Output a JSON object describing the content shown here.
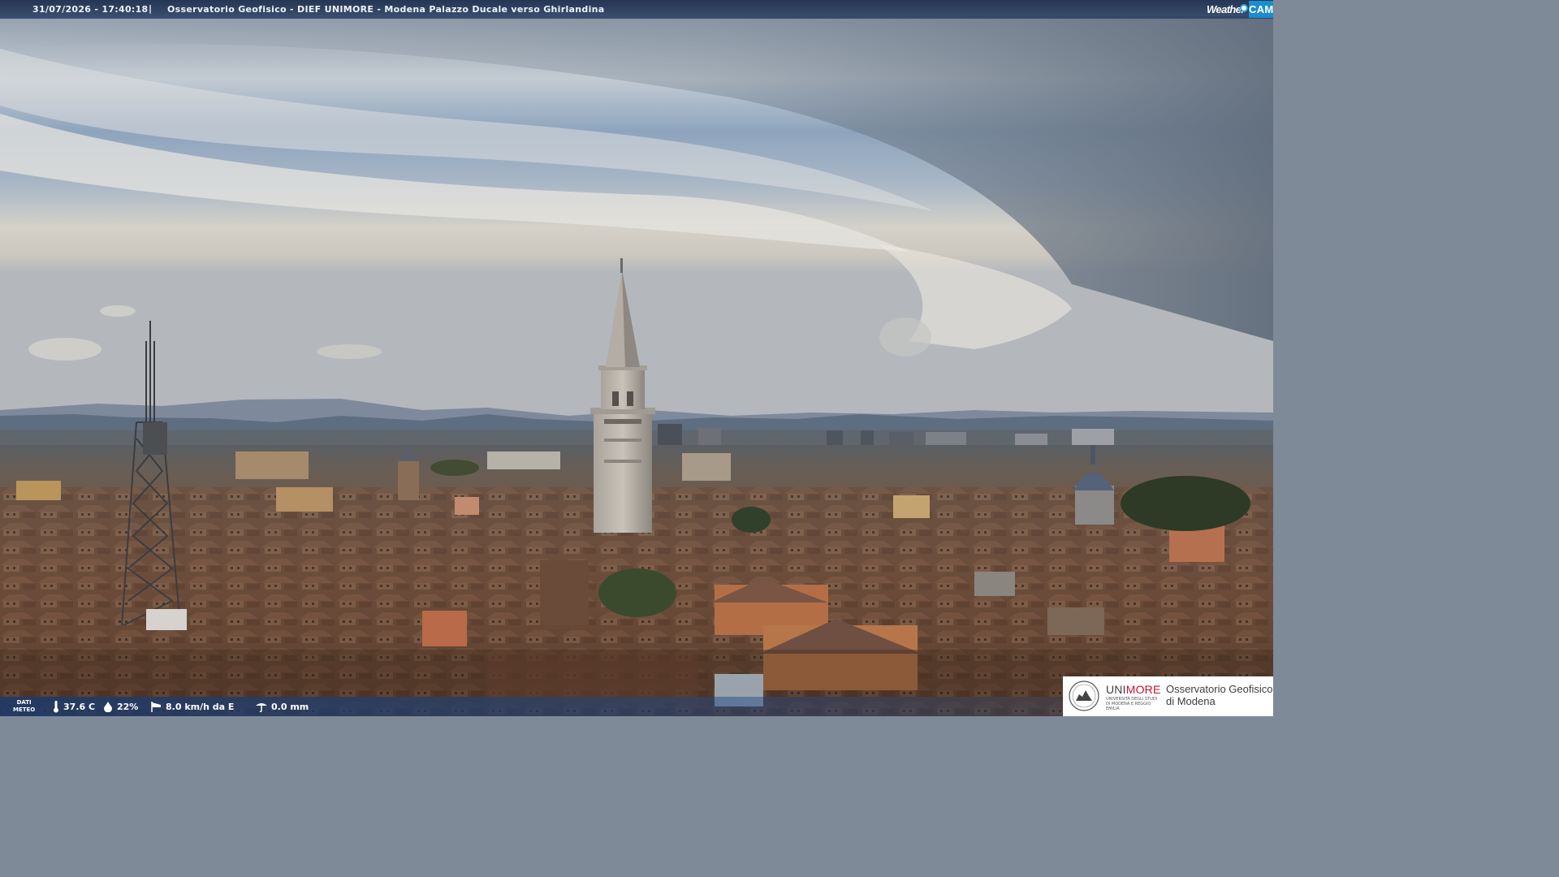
{
  "banner": {
    "timestamp": "31/07/2026 - 17:40:18",
    "separator": "|",
    "camera_title": "Osservatorio Geofisico - DIEF UNIMORE - Modena Palazzo Ducale verso Ghirlandina",
    "brand_word": "Weather",
    "brand_cam": "CAM"
  },
  "weather": {
    "label_line1": "DATI",
    "label_line2": "METEO",
    "temperature": "37.6 C",
    "humidity": "22%",
    "wind": "8.0 km/h da E",
    "rain": "0.0 mm"
  },
  "logo": {
    "uni_part1": "UNI",
    "uni_part2": "MORE",
    "uni_sub": "UNIVERSITÀ DEGLI STUDI DI MODENA E REGGIO EMILIA",
    "obs_line1": "Osservatorio Geofisico",
    "obs_line2": "di Modena"
  },
  "icons": {
    "temperature": "thermometer-icon",
    "humidity": "droplet-icon",
    "wind": "windsock-icon",
    "rain": "rain-gauge-icon"
  },
  "colors": {
    "banner": "#1c2e4c",
    "brand_blue": "#1b8ccd",
    "unimore_red": "#c8102e"
  }
}
